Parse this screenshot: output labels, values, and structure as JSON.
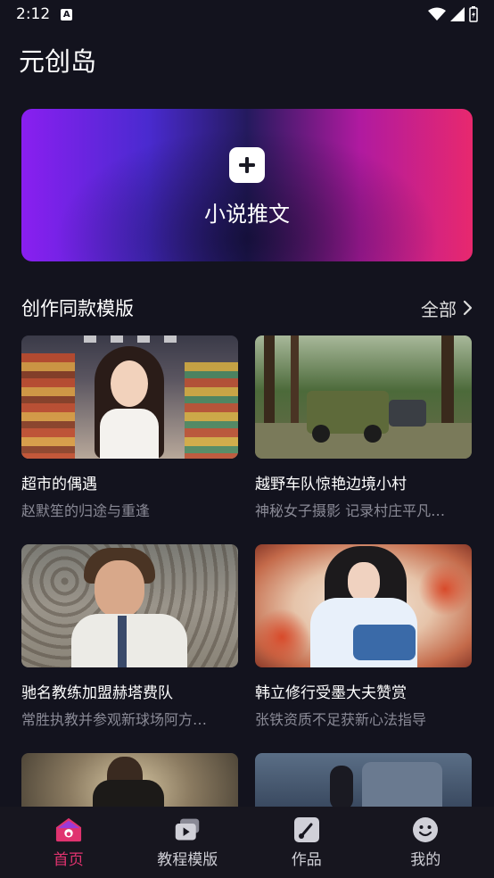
{
  "status": {
    "time": "2:12",
    "a_badge": "A"
  },
  "app": {
    "title": "元创岛"
  },
  "hero": {
    "label": "小说推文"
  },
  "section": {
    "title": "创作同款模版",
    "more": "全部"
  },
  "cards": [
    {
      "title": "超市的偶遇",
      "subtitle": "赵默笙的归途与重逢"
    },
    {
      "title": "越野车队惊艳边境小村",
      "subtitle": "神秘女子摄影 记录村庄平凡…"
    },
    {
      "title": "驰名教练加盟赫塔费队",
      "subtitle": "常胜执教并参观新球场阿方…"
    },
    {
      "title": "韩立修行受墨大夫赞赏",
      "subtitle": "张铁资质不足获新心法指导"
    },
    {
      "title": "",
      "subtitle": ""
    },
    {
      "title": "",
      "subtitle": ""
    }
  ],
  "tabs": [
    {
      "label": "首页",
      "icon": "home-icon",
      "active": true
    },
    {
      "label": "教程模版",
      "icon": "tutorial-icon",
      "active": false
    },
    {
      "label": "作品",
      "icon": "works-icon",
      "active": false
    },
    {
      "label": "我的",
      "icon": "profile-icon",
      "active": false
    }
  ],
  "colors": {
    "accent": "#e0336f",
    "background": "#13131e"
  }
}
